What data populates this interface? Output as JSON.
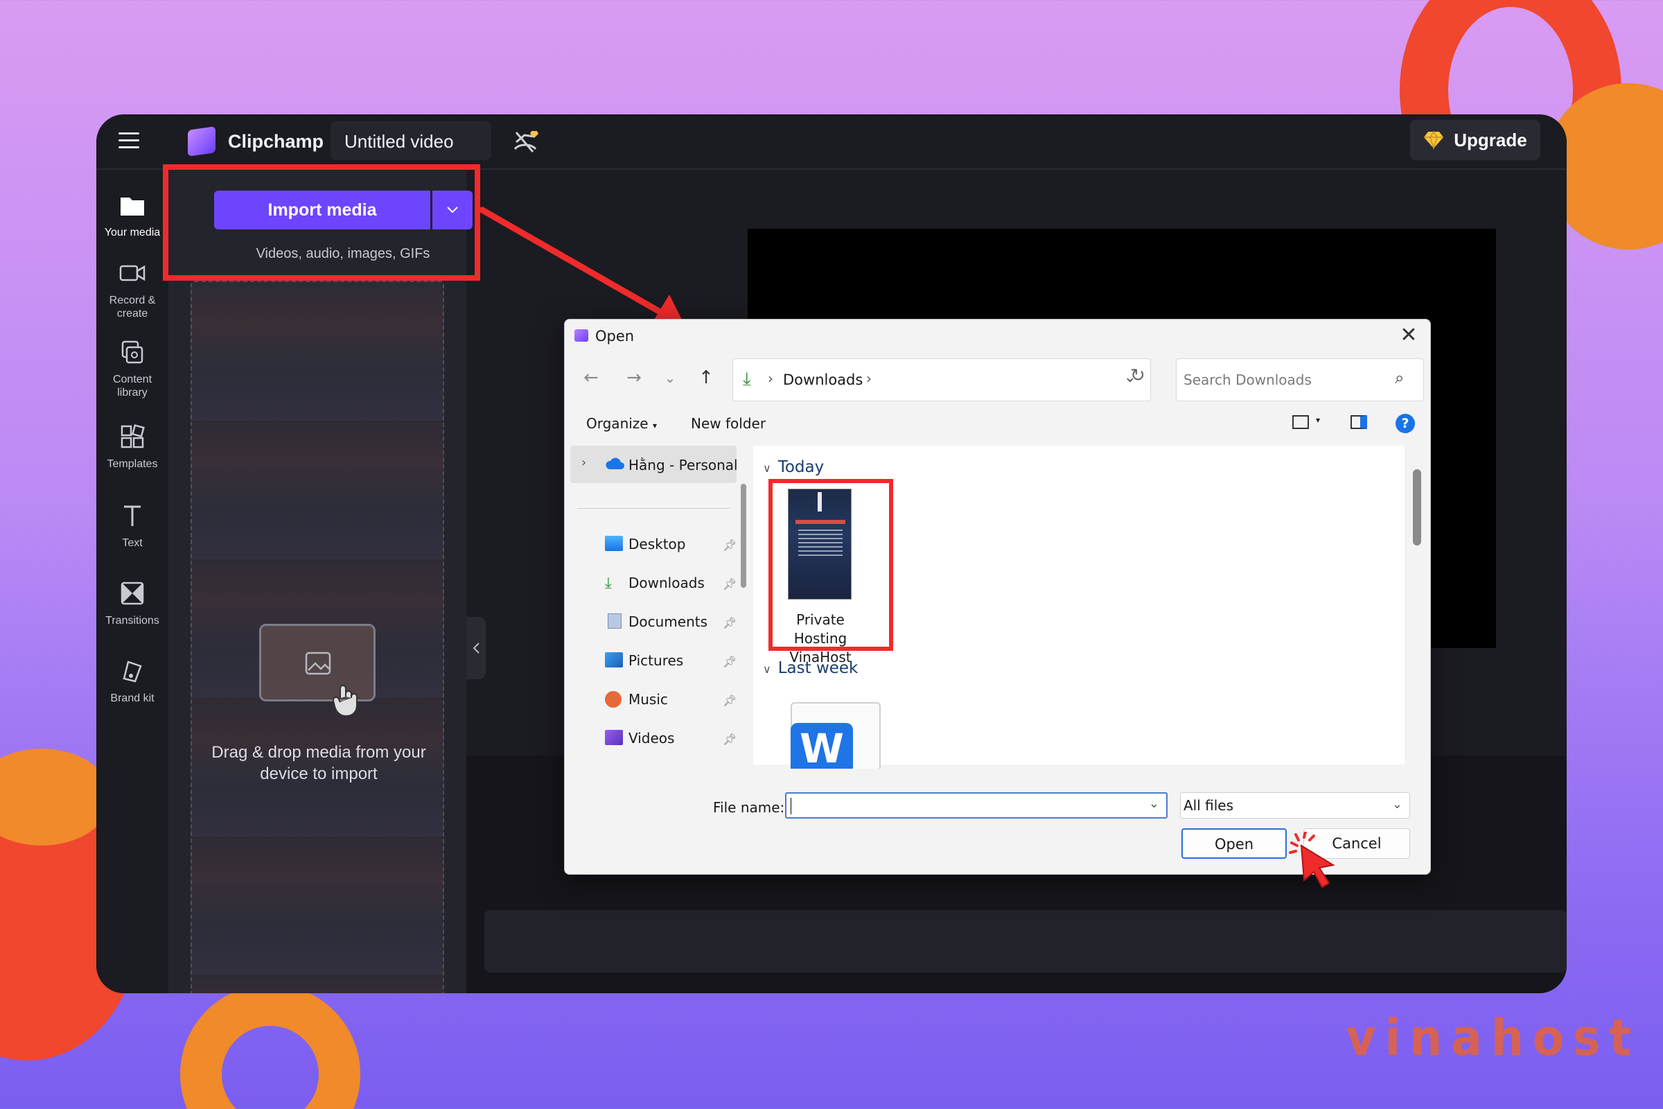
{
  "app": {
    "brand_name": "Clipchamp",
    "project_title": "Untitled video",
    "upgrade_label": "Upgrade",
    "accent_color": "#6e45ff"
  },
  "rail": {
    "items": [
      {
        "label": "Your media",
        "icon": "folder-icon"
      },
      {
        "label": "Record & create",
        "icon": "camera-icon"
      },
      {
        "label": "Content library",
        "icon": "library-icon"
      },
      {
        "label": "Templates",
        "icon": "templates-icon"
      },
      {
        "label": "Text",
        "icon": "text-icon"
      },
      {
        "label": "Transitions",
        "icon": "transitions-icon"
      },
      {
        "label": "Brand kit",
        "icon": "brand-kit-icon"
      }
    ]
  },
  "media_panel": {
    "import_label": "Import media",
    "import_sub": "Videos, audio, images, GIFs",
    "drop_text": "Drag & drop media from your device to import"
  },
  "dialog": {
    "title": "Open",
    "breadcrumb": "Downloads",
    "search_placeholder": "Search Downloads",
    "organize_label": "Organize",
    "new_folder_label": "New folder",
    "nav": {
      "root": "Hằng - Personal",
      "items": [
        "Desktop",
        "Downloads",
        "Documents",
        "Pictures",
        "Music",
        "Videos"
      ]
    },
    "groups": [
      {
        "label": "Today",
        "files": [
          {
            "name": "Private Hosting VinaHost"
          }
        ]
      },
      {
        "label": "Last week",
        "files": [
          {
            "name": ""
          }
        ]
      }
    ],
    "file_name_label": "File name:",
    "file_name_value": "",
    "file_type": "All files",
    "open_label": "Open",
    "cancel_label": "Cancel"
  },
  "watermark": "vinahost"
}
